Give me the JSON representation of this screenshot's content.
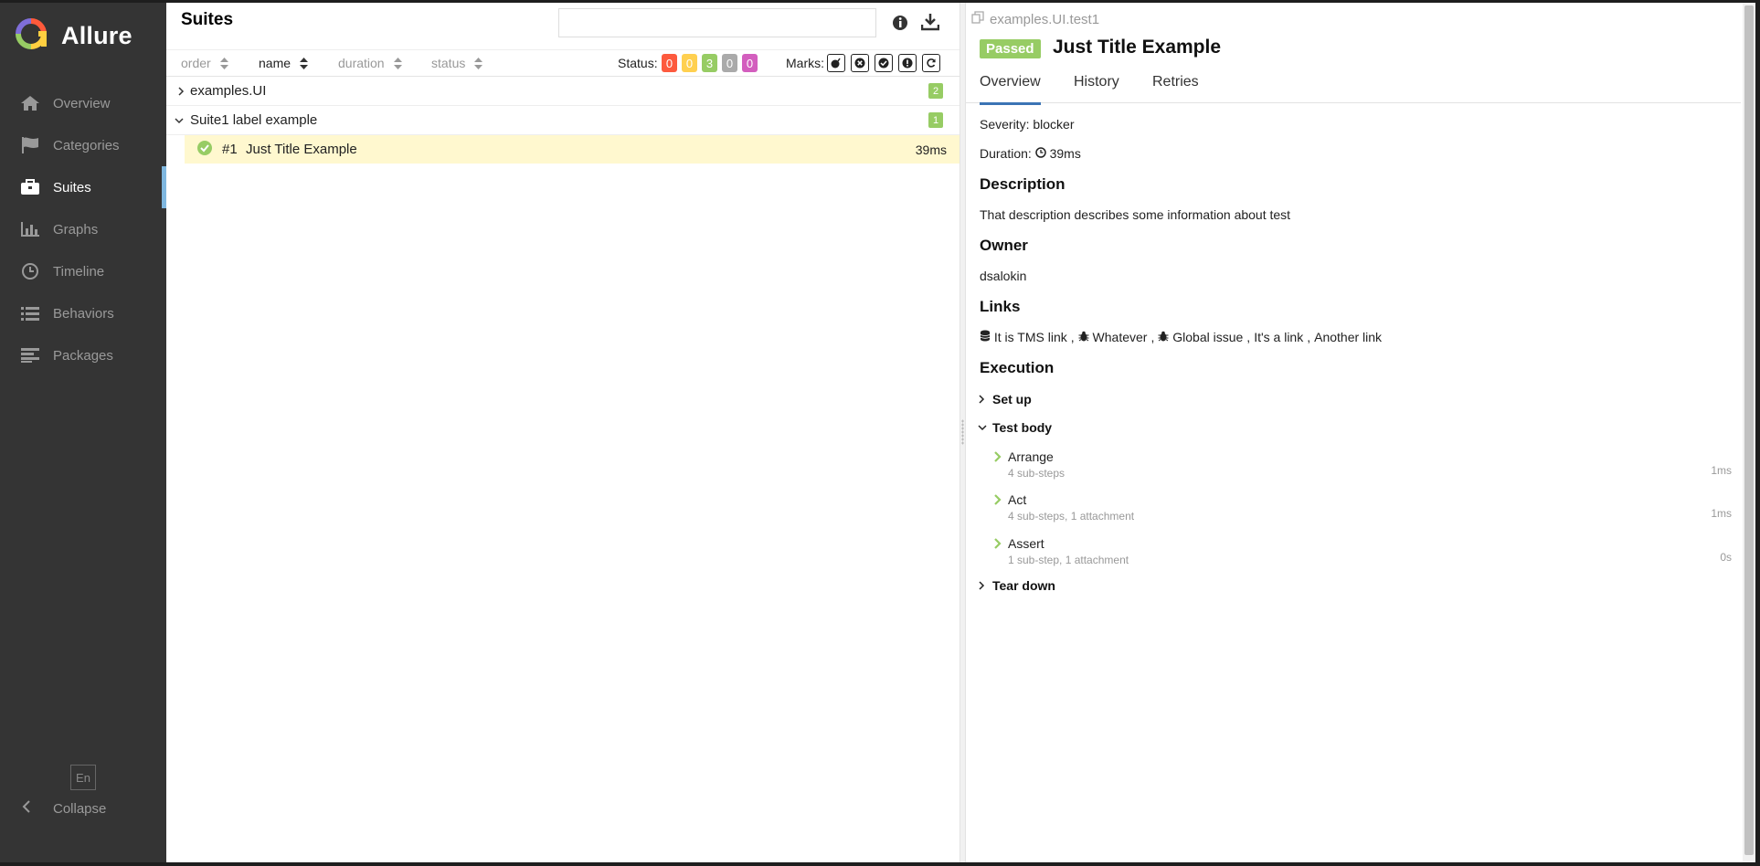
{
  "app": {
    "name": "Allure"
  },
  "sidebar": {
    "items": [
      {
        "label": "Overview",
        "icon": "home-icon"
      },
      {
        "label": "Categories",
        "icon": "flag-icon"
      },
      {
        "label": "Suites",
        "icon": "briefcase-icon",
        "active": true
      },
      {
        "label": "Graphs",
        "icon": "bar-chart-icon"
      },
      {
        "label": "Timeline",
        "icon": "clock-icon"
      },
      {
        "label": "Behaviors",
        "icon": "list-icon"
      },
      {
        "label": "Packages",
        "icon": "align-left-icon"
      }
    ],
    "language": "En",
    "collapse_label": "Collapse"
  },
  "suites": {
    "title": "Suites",
    "search_placeholder": "",
    "sort": {
      "order": "order",
      "name": "name",
      "duration": "duration",
      "status": "status"
    },
    "status_label": "Status:",
    "status_counts": [
      {
        "value": "0",
        "color": "#fd5a3e"
      },
      {
        "value": "0",
        "color": "#ffd050"
      },
      {
        "value": "3",
        "color": "#97cc64"
      },
      {
        "value": "0",
        "color": "#aaaaaa"
      },
      {
        "value": "0",
        "color": "#d35ebe"
      }
    ],
    "marks_label": "Marks:",
    "tree": [
      {
        "name": "examples.UI",
        "count": "2",
        "expanded": false
      },
      {
        "name": "Suite1 label example",
        "count": "1",
        "expanded": true
      }
    ],
    "test": {
      "number": "#1",
      "name": "Just Title Example",
      "duration": "39ms",
      "status_color": "#97cc64"
    }
  },
  "detail": {
    "breadcrumb": "examples.UI.test1",
    "status": "Passed",
    "title": "Just Title Example",
    "tabs": [
      "Overview",
      "History",
      "Retries"
    ],
    "severity_label": "Severity:",
    "severity": "blocker",
    "duration_label": "Duration:",
    "duration": "39ms",
    "description_heading": "Description",
    "description": "That description describes some information about test",
    "owner_heading": "Owner",
    "owner": "dsalokin",
    "links_heading": "Links",
    "links": {
      "tms": "It is TMS link",
      "issue1": "Whatever",
      "issue2": "Global issue",
      "link1": "It's a link",
      "link2": "Another link"
    },
    "execution_heading": "Execution",
    "setup_label": "Set up",
    "body_label": "Test body",
    "steps": [
      {
        "name": "Arrange",
        "sub": "4 sub-steps",
        "duration": "1ms"
      },
      {
        "name": "Act",
        "sub": "4 sub-steps, 1 attachment",
        "duration": "1ms"
      },
      {
        "name": "Assert",
        "sub": "1 sub-step, 1 attachment",
        "duration": "0s"
      }
    ],
    "teardown_label": "Tear down"
  }
}
